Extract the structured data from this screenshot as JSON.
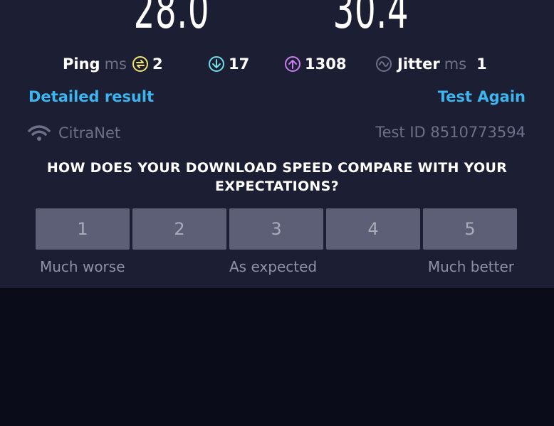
{
  "results": {
    "download_value": "28.0",
    "upload_value": "30.4"
  },
  "stats": {
    "ping_label": "Ping",
    "ping_unit": "ms",
    "ping_value": "2",
    "download_latency": "17",
    "upload_latency": "1308",
    "jitter_label": "Jitter",
    "jitter_unit": "ms",
    "jitter_value": "1"
  },
  "links": {
    "detailed_result": "Detailed result",
    "test_again": "Test Again"
  },
  "meta": {
    "provider": "CitraNet",
    "test_id": "Test ID 8510773594"
  },
  "survey": {
    "question": "HOW DOES YOUR DOWNLOAD SPEED COMPARE WITH YOUR EXPECTATIONS?",
    "options": [
      "1",
      "2",
      "3",
      "4",
      "5"
    ],
    "label_low": "Much worse",
    "label_mid": "As expected",
    "label_high": "Much better"
  },
  "colors": {
    "panel_bg": "#1c1e33",
    "page_bg": "#0b0c1a",
    "link": "#3db5ee",
    "ping_icon": "#f1e36b",
    "download_icon": "#6ee0e8",
    "upload_icon": "#c97df0",
    "jitter_icon": "#6d7088",
    "rating_button": "#5c5f75"
  },
  "icons": {
    "ping": "ping-icon",
    "download": "download-arrow-icon",
    "upload": "upload-arrow-icon",
    "jitter": "jitter-wave-icon",
    "provider": "wifi-icon"
  }
}
